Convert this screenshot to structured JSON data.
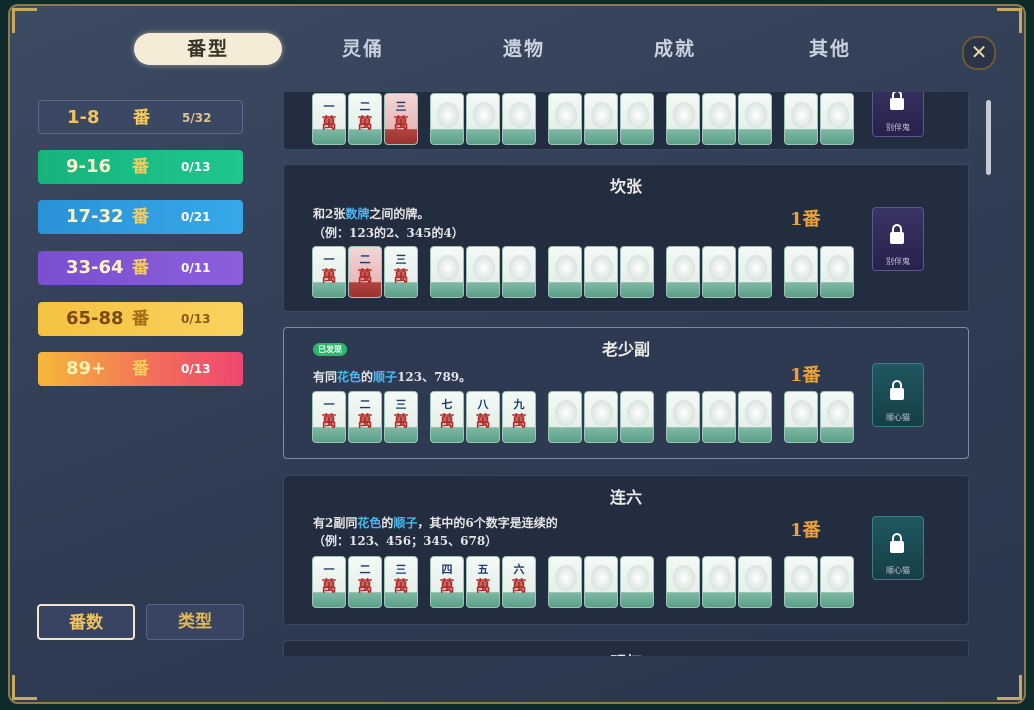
{
  "tabs": [
    {
      "label": "番型",
      "active": true
    },
    {
      "label": "灵俑",
      "active": false
    },
    {
      "label": "遗物",
      "active": false
    },
    {
      "label": "成就",
      "active": false
    },
    {
      "label": "其他",
      "active": false
    }
  ],
  "close_icon": "✕",
  "sidebar": {
    "fan_char": "番",
    "ranges": [
      {
        "label": "1-8",
        "count": "5/32"
      },
      {
        "label": "9-16",
        "count": "0/13"
      },
      {
        "label": "17-32",
        "count": "0/21"
      },
      {
        "label": "33-64",
        "count": "0/11"
      },
      {
        "label": "65-88",
        "count": "0/13"
      },
      {
        "label": "89+",
        "count": "0/13"
      }
    ],
    "sort_buttons": [
      {
        "label": "番数",
        "active": true
      },
      {
        "label": "类型",
        "active": false
      }
    ]
  },
  "cards": [
    {
      "title": "",
      "fan": "",
      "tiles": [
        "一",
        "二",
        "三"
      ],
      "reward_name": "别伴鬼"
    },
    {
      "title": "坎张",
      "desc_pre": "和2张",
      "desc_kw": "数牌",
      "desc_post": "之间的牌。",
      "desc2": "（例：123的2、345的4）",
      "fan": "1番",
      "tiles": [
        "一",
        "二",
        "三"
      ],
      "red_index": 1,
      "reward_name": "别伴鬼"
    },
    {
      "title": "老少副",
      "badge": "已发现",
      "desc_pre": "有同",
      "desc_kw": "花色",
      "desc_mid": "的",
      "desc_kw2": "顺子",
      "desc_post": "123、789。",
      "fan": "1番",
      "tiles": [
        "一",
        "二",
        "三",
        "七",
        "八",
        "九"
      ],
      "reward_name": "顺心猫"
    },
    {
      "title": "连六",
      "desc_pre": "有2副同",
      "desc_kw": "花色",
      "desc_mid": "的",
      "desc_kw2": "顺子",
      "desc_post": "，其中的6个数字是连续的",
      "desc2": "（例：123、456；345、678）",
      "fan": "1番",
      "tiles": [
        "一",
        "二",
        "三",
        "四",
        "五",
        "六"
      ],
      "reward_name": "顺心猫"
    },
    {
      "title": "明杠"
    }
  ],
  "tile_suit": "萬",
  "colors": {
    "accent_gold": "#f0c457",
    "keyword_blue": "#4ab8ef",
    "fan_orange": "#eba13a"
  }
}
